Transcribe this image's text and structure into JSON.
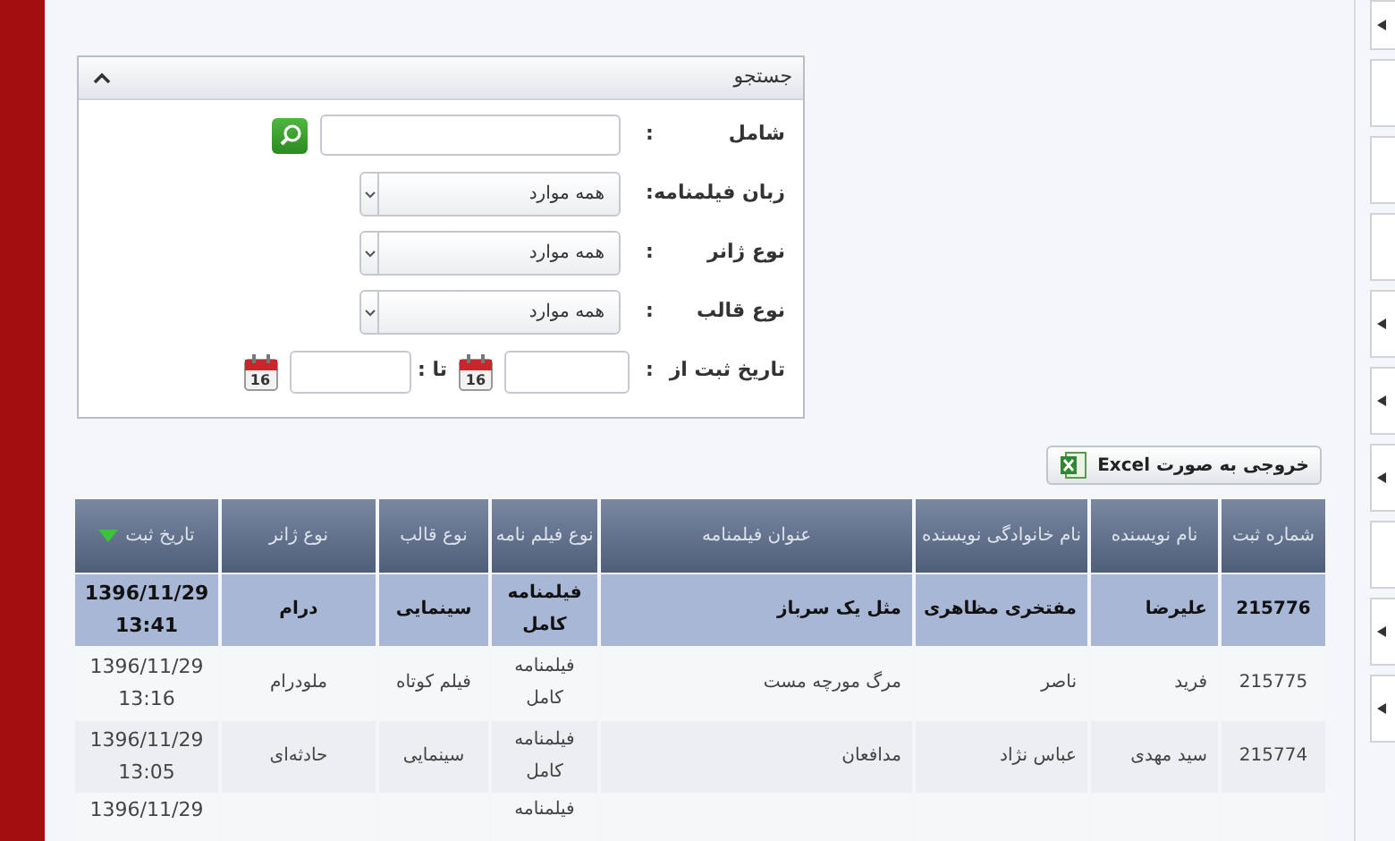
{
  "search_panel": {
    "title": "جستجو",
    "expanded": true,
    "fields": [
      {
        "kind": "text",
        "label": "شامل",
        "separator": ":"
      },
      {
        "kind": "select",
        "label": "زبان فیلمنامه",
        "separator": ":",
        "value": "همه موارد"
      },
      {
        "kind": "select",
        "label": "نوع ژانر",
        "separator": ":",
        "value": "همه موارد"
      },
      {
        "kind": "select",
        "label": "نوع قالب",
        "separator": ":",
        "value": "همه موارد"
      },
      {
        "kind": "date_range",
        "label": "تاریخ ثبت از",
        "separator": ":",
        "to_label": "تا :",
        "from_calendar_day": "16",
        "to_calendar_day": "16"
      }
    ]
  },
  "export_button": {
    "label": "خروجی به صورت Excel"
  },
  "table": {
    "columns": [
      {
        "label": "شماره ثبت",
        "sorted": false
      },
      {
        "label": "نام نویسنده",
        "sorted": false
      },
      {
        "label": "نام خانوادگی نویسنده",
        "sorted": false
      },
      {
        "label": "عنوان فیلمنامه",
        "sorted": false
      },
      {
        "label": "نوع فیلم نامه",
        "sorted": false
      },
      {
        "label": "نوع قالب",
        "sorted": false
      },
      {
        "label": "نوع ژانر",
        "sorted": false
      },
      {
        "label": "تاریخ ثبت",
        "sorted": true
      }
    ],
    "rows": [
      {
        "selected": true,
        "cells": [
          "215776",
          "علیرضا",
          "مفتخری مظاهری",
          "مثل یک سرباز",
          "فیلمنامه کامل",
          "سینمایی",
          "درام",
          "1396/11/29 13:41"
        ]
      },
      {
        "selected": false,
        "cells": [
          "215775",
          "فرید",
          "ناصر",
          "مرگ مورچه مست",
          "فیلمنامه کامل",
          "فیلم کوتاه",
          "ملودرام",
          "1396/11/29 13:16"
        ]
      },
      {
        "selected": false,
        "cells": [
          "215774",
          "سید مهدی",
          "عباس نژاد",
          "مدافعان",
          "فیلمنامه کامل",
          "سینمایی",
          "حادثه‌ای",
          "1396/11/29 13:05"
        ]
      },
      {
        "selected": false,
        "cells": [
          null,
          null,
          null,
          null,
          "فیلمنامه",
          null,
          null,
          "1396/11/29"
        ]
      }
    ]
  },
  "sidebar": {
    "items": [
      {
        "has_bullet": true
      },
      {
        "has_bullet": false
      },
      {
        "has_bullet": false
      },
      {
        "has_bullet": false
      },
      {
        "has_bullet": true
      },
      {
        "has_bullet": true
      },
      {
        "has_bullet": true
      },
      {
        "has_bullet": false
      },
      {
        "has_bullet": true
      },
      {
        "has_bullet": true
      }
    ]
  }
}
